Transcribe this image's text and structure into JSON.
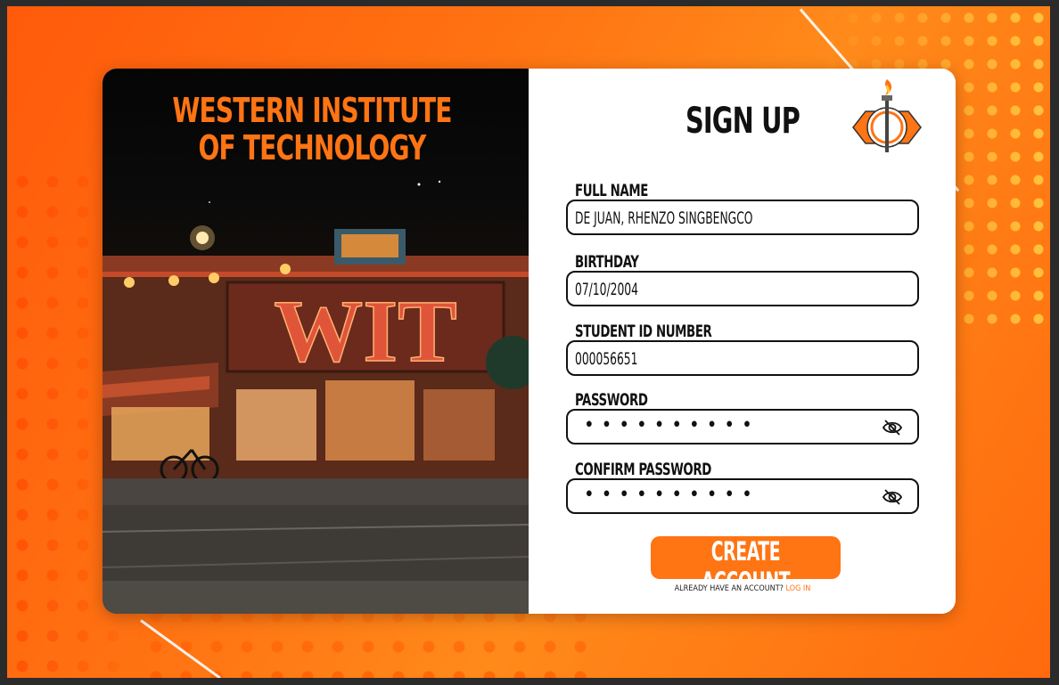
{
  "banner": {
    "school_name_line1": "WESTERN INSTITUTE",
    "school_name_line2": "OF TECHNOLOGY",
    "sign_text": "WIT"
  },
  "form": {
    "title": "SIGN UP",
    "fields": [
      {
        "label": "FULL NAME",
        "value": "DE JUAN, RHENZO SINGBENGCO"
      },
      {
        "label": "BIRTHDAY",
        "value": "07/10/2004"
      },
      {
        "label": "STUDENT ID NUMBER",
        "value": "000056651"
      },
      {
        "label": "PASSWORD",
        "value": "••••••••••"
      },
      {
        "label": "CONFIRM PASSWORD",
        "value": "••••••••••"
      }
    ],
    "submit_label": "CREATE ACCOUNT",
    "login_prompt": "ALREADY HAVE AN ACCOUNT?",
    "login_link": "LOG IN"
  },
  "icons": {
    "password_toggle": "eye-slash-icon",
    "logo": "torch-emblem-logo"
  },
  "colors": {
    "accent": "#ff7413",
    "background": "#ff6a0e",
    "text": "#111111"
  }
}
